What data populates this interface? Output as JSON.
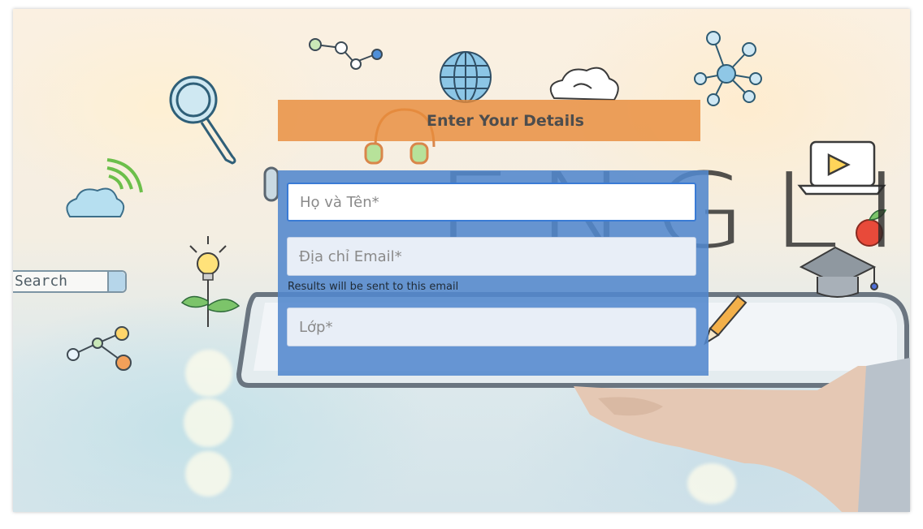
{
  "header": {
    "title": "Enter Your Details"
  },
  "form": {
    "name_field": {
      "placeholder": "Họ và Tên*",
      "value": ""
    },
    "email_field": {
      "placeholder": "Địa chỉ Email*",
      "value": ""
    },
    "email_hint": "Results will be sent to this email",
    "class_field": {
      "placeholder": "Lớp*",
      "value": ""
    }
  },
  "background": {
    "search_label": "Search",
    "english_label": "ENGLISH",
    "icons": [
      "magnifier-icon",
      "network-icon",
      "globe-icon",
      "cloud-icon",
      "headphones-icon",
      "wifi-cloud-icon",
      "lightbulb-plant-icon",
      "share-icon",
      "laptop-play-icon",
      "apple-icon",
      "graduation-cap-icon",
      "pencil-icon",
      "tablet-icon",
      "hand-icon"
    ]
  },
  "colors": {
    "header_bar": "#e88c3c",
    "form_panel": "#5287cd",
    "focus_border": "#3a7bd5"
  }
}
